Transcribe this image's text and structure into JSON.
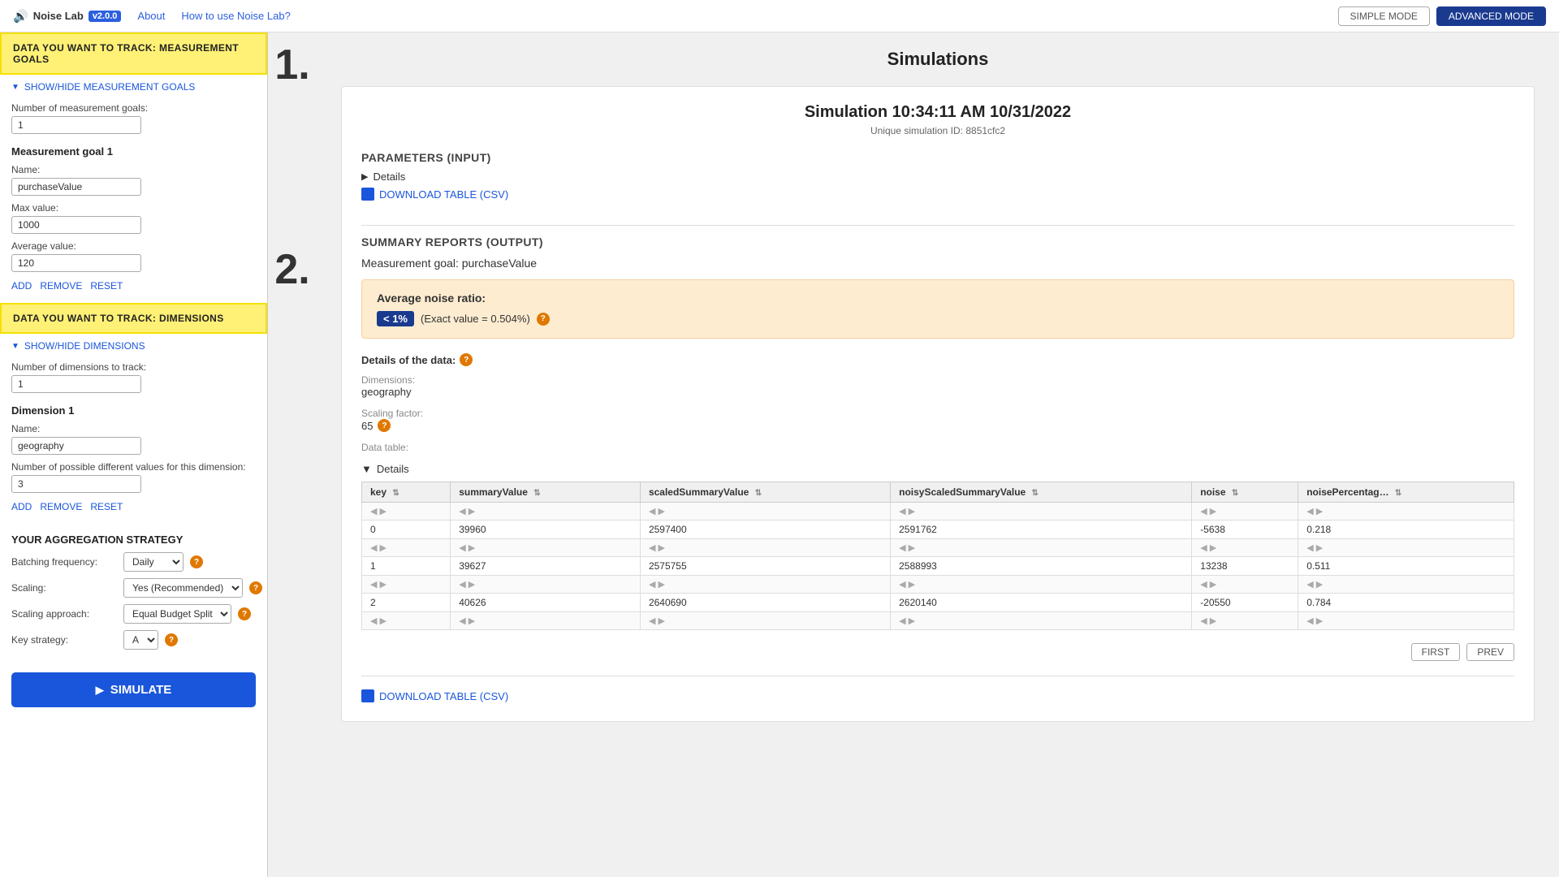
{
  "topnav": {
    "logo_text": "Noise Lab",
    "version": "v2.0.0",
    "about": "About",
    "how_to": "How to use Noise Lab?",
    "simple_mode": "SIMPLE MODE",
    "advanced_mode": "ADVANCED MODE"
  },
  "sidebar": {
    "section1_title": "DATA YOU WANT TO TRACK: MEASUREMENT GOALS",
    "section1_toggle": "SHOW/HIDE MEASUREMENT GOALS",
    "num_goals_label": "Number of measurement goals:",
    "num_goals_value": "1",
    "goal1_title": "Measurement goal 1",
    "goal1_name_label": "Name:",
    "goal1_name_value": "purchaseValue",
    "goal1_max_label": "Max value:",
    "goal1_max_value": "1000",
    "goal1_avg_label": "Average value:",
    "goal1_avg_value": "120",
    "actions1": [
      "ADD",
      "REMOVE",
      "RESET"
    ],
    "section2_title": "DATA YOU WANT TO TRACK: DIMENSIONS",
    "section2_toggle": "SHOW/HIDE DIMENSIONS",
    "num_dims_label": "Number of dimensions to track:",
    "num_dims_value": "1",
    "dim1_title": "Dimension 1",
    "dim1_name_label": "Name:",
    "dim1_name_value": "geography",
    "dim1_possible_label": "Number of possible different values for this dimension:",
    "dim1_possible_value": "3",
    "actions2": [
      "ADD",
      "REMOVE",
      "RESET"
    ],
    "agg_title": "YOUR AGGREGATION STRATEGY",
    "batching_label": "Batching frequency:",
    "batching_value": "Daily",
    "scaling_label": "Scaling:",
    "scaling_value": "Yes (Recommended)",
    "scaling_approach_label": "Scaling approach:",
    "scaling_approach_value": "Equal Budget Split",
    "key_strategy_label": "Key strategy:",
    "key_strategy_value": "A",
    "simulate_btn": "SIMULATE"
  },
  "main": {
    "title": "Simulations",
    "step1_num": "1.",
    "step2_num": "2.",
    "sim_title": "Simulation 10:34:11 AM 10/31/2022",
    "sim_id_label": "Unique simulation ID: 8851cfc2",
    "params_header": "PARAMETERS (INPUT)",
    "details_label": "Details",
    "download_csv_label": "DOWNLOAD TABLE (CSV)",
    "summary_header": "SUMMARY REPORTS (OUTPUT)",
    "measurement_goal_label": "Measurement goal: purchaseValue",
    "noise_ratio_title": "Average noise ratio:",
    "noise_ratio_badge": "< 1%",
    "noise_ratio_exact": "(Exact value = 0.504%)",
    "details_of_data_label": "Details of the data:",
    "dimensions_label": "Dimensions:",
    "dimensions_value": "geography",
    "scaling_factor_label": "Scaling factor:",
    "scaling_factor_value": "65",
    "data_table_label": "Data table:",
    "table_details_label": "Details",
    "table_headers": [
      "key",
      "summaryValue",
      "scaledSummaryValue",
      "noisyScaledSummaryValue",
      "noise",
      "noisePercentage"
    ],
    "table_rows": [
      {
        "key": "0",
        "summaryValue": "39960",
        "scaledSummaryValue": "2597400",
        "noisyScaledSummaryValue": "2591762",
        "noise": "-5638",
        "noisePercentage": "0.218"
      },
      {
        "key": "1",
        "summaryValue": "39627",
        "scaledSummaryValue": "2575755",
        "noisyScaledSummaryValue": "2588993",
        "noise": "13238",
        "noisePercentage": "0.511"
      },
      {
        "key": "2",
        "summaryValue": "40626",
        "scaledSummaryValue": "2640690",
        "noisyScaledSummaryValue": "2620140",
        "noise": "-20550",
        "noisePercentage": "0.784"
      }
    ],
    "pagination_first": "FIRST",
    "pagination_prev": "PREV",
    "download_bottom_label": "DOWNLOAD TABLE (CSV)"
  }
}
